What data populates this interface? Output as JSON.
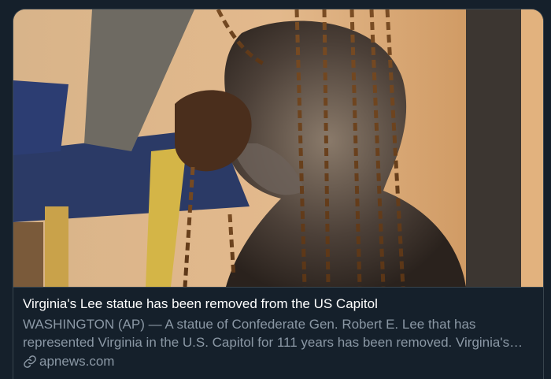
{
  "card": {
    "title": "Virginia's Lee statue has been removed from the US Capitol",
    "description": "WASHINGTON (AP) — A statue of Confederate Gen. Robert E. Lee that has represented Virginia in the U.S. Capitol for 111 years has been removed. Virginia's…",
    "domain": "apnews.com",
    "link_icon": "link-icon"
  },
  "colors": {
    "background": "#15202b",
    "border": "#38444d",
    "title": "#ffffff",
    "secondary_text": "#8b98a5"
  }
}
